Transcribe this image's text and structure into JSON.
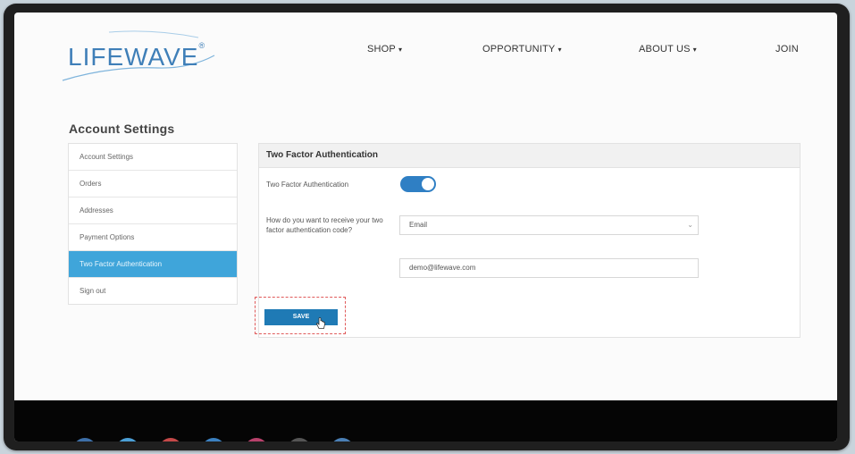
{
  "brand": {
    "logo_text": "LIFEWAVE",
    "logo_mark": "®",
    "color": "#3f7fb8"
  },
  "nav": {
    "shop": "SHOP",
    "opportunity": "OPPORTUNITY",
    "about": "ABOUT US",
    "join": "JOIN"
  },
  "page_title": "Account Settings",
  "sidebar": {
    "items": [
      {
        "label": "Account Settings"
      },
      {
        "label": "Orders"
      },
      {
        "label": "Addresses"
      },
      {
        "label": "Payment Options"
      },
      {
        "label": "Two Factor Authentication"
      },
      {
        "label": "Sign out"
      }
    ],
    "active_color": "#3fa5da"
  },
  "panel": {
    "title": "Two Factor Authentication",
    "toggle_label": "Two Factor Authentication",
    "toggle_on": true,
    "method_label": "How do you want to receive your two factor authentication code?",
    "method_value": "Email",
    "email_value": "demo@lifewave.com",
    "save_label": "SAVE"
  },
  "icons": {
    "nav_caret": "caret-down-icon",
    "select_chevron": "chevron-down-icon",
    "cursor": "hand-pointer-icon"
  },
  "colors": {
    "accent": "#2f7fc4",
    "save_button": "#1f7ab5",
    "highlight": "#e05a5a"
  }
}
